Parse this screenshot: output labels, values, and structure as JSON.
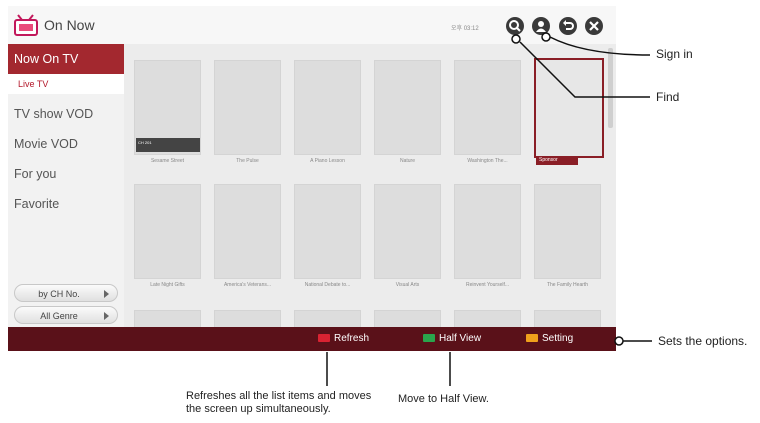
{
  "app": {
    "title": "On Now",
    "clock": "오후 03:12"
  },
  "sidebar": {
    "items": [
      {
        "label": "Now On TV",
        "active": true
      },
      {
        "label": "TV show VOD"
      },
      {
        "label": "Movie VOD"
      },
      {
        "label": "For you"
      },
      {
        "label": "Favorite"
      }
    ],
    "sub_item": "Live TV",
    "filters": [
      {
        "label": "by CH No."
      },
      {
        "label": "All Genre"
      }
    ]
  },
  "tiles_row1": [
    {
      "caption": "Sesame Street",
      "badge": "CH 201"
    },
    {
      "caption": "The Pulse"
    },
    {
      "caption": "A Piano Lesson"
    },
    {
      "caption": "Nature"
    },
    {
      "caption": "Washington The..."
    },
    {
      "caption": "",
      "tag": "Sponsor"
    }
  ],
  "tiles_row2": [
    {
      "caption": "Late Night Gifts"
    },
    {
      "caption": "America's Veterans..."
    },
    {
      "caption": "National Debate to..."
    },
    {
      "caption": "Visual Arts"
    },
    {
      "caption": "Reinvent Yourself..."
    },
    {
      "caption": "The Family Hearth"
    }
  ],
  "bottom_bar": {
    "refresh_label": "Refresh",
    "half_view_label": "Half View",
    "setting_label": "Setting"
  },
  "colors": {
    "accent": "#a3282f",
    "bottom_bar": "#5a1119",
    "red_key": "#d92332",
    "green_key": "#2aa54c",
    "yellow_key": "#f0a01c"
  },
  "callouts": {
    "sign_in": "Sign in",
    "find": "Find",
    "sets_options": "Sets the options.",
    "refresh_note_line1": "Refreshes all the list items and moves",
    "refresh_note_line2": "the screen up simultaneously.",
    "half_view_note": "Move to Half View."
  },
  "icons": [
    "app-logo-icon",
    "search-icon",
    "user-icon",
    "back-icon",
    "close-icon"
  ]
}
